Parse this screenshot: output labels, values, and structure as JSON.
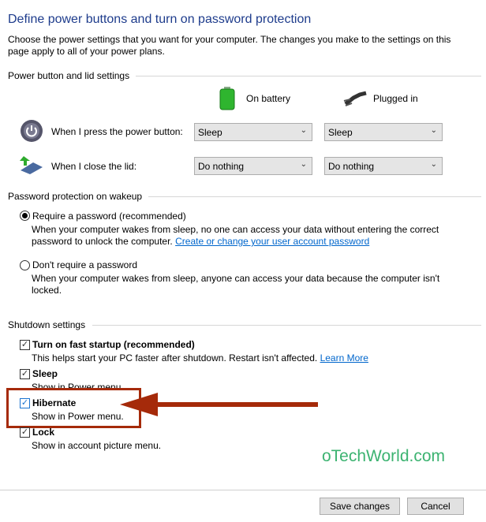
{
  "title": "Define power buttons and turn on password protection",
  "intro": "Choose the power settings that you want for your computer. The changes you make to the settings on this page apply to all of your power plans.",
  "power_section": {
    "heading": "Power button and lid settings",
    "on_battery": "On battery",
    "plugged_in": "Plugged in",
    "rows": [
      {
        "label": "When I press the power button:",
        "battery": "Sleep",
        "plugged": "Sleep"
      },
      {
        "label": "When I close the lid:",
        "battery": "Do nothing",
        "plugged": "Do nothing"
      }
    ]
  },
  "password_section": {
    "heading": "Password protection on wakeup",
    "require": {
      "label": "Require a password (recommended)",
      "selected": true,
      "desc": "When your computer wakes from sleep, no one can access your data without entering the correct password to unlock the computer.",
      "link": "Create or change your user account password"
    },
    "dont": {
      "label": "Don't require a password",
      "selected": false,
      "desc": "When your computer wakes from sleep, anyone can access your data because the computer isn't locked."
    }
  },
  "shutdown_section": {
    "heading": "Shutdown settings",
    "items": [
      {
        "label": "Turn on fast startup (recommended)",
        "checked": true,
        "desc": "This helps start your PC faster after shutdown. Restart isn't affected.",
        "link": "Learn More"
      },
      {
        "label": "Sleep",
        "checked": true,
        "desc": "Show in Power menu."
      },
      {
        "label": "Hibernate",
        "checked": true,
        "desc": "Show in Power menu."
      },
      {
        "label": "Lock",
        "checked": true,
        "desc": "Show in account picture menu."
      }
    ]
  },
  "watermark": "oTechWorld.com",
  "buttons": {
    "save": "Save changes",
    "cancel": "Cancel"
  },
  "colors": {
    "title": "#1e3c8c",
    "highlight": "#a52a0a",
    "watermark": "#3cb371",
    "link": "#0066cc"
  }
}
